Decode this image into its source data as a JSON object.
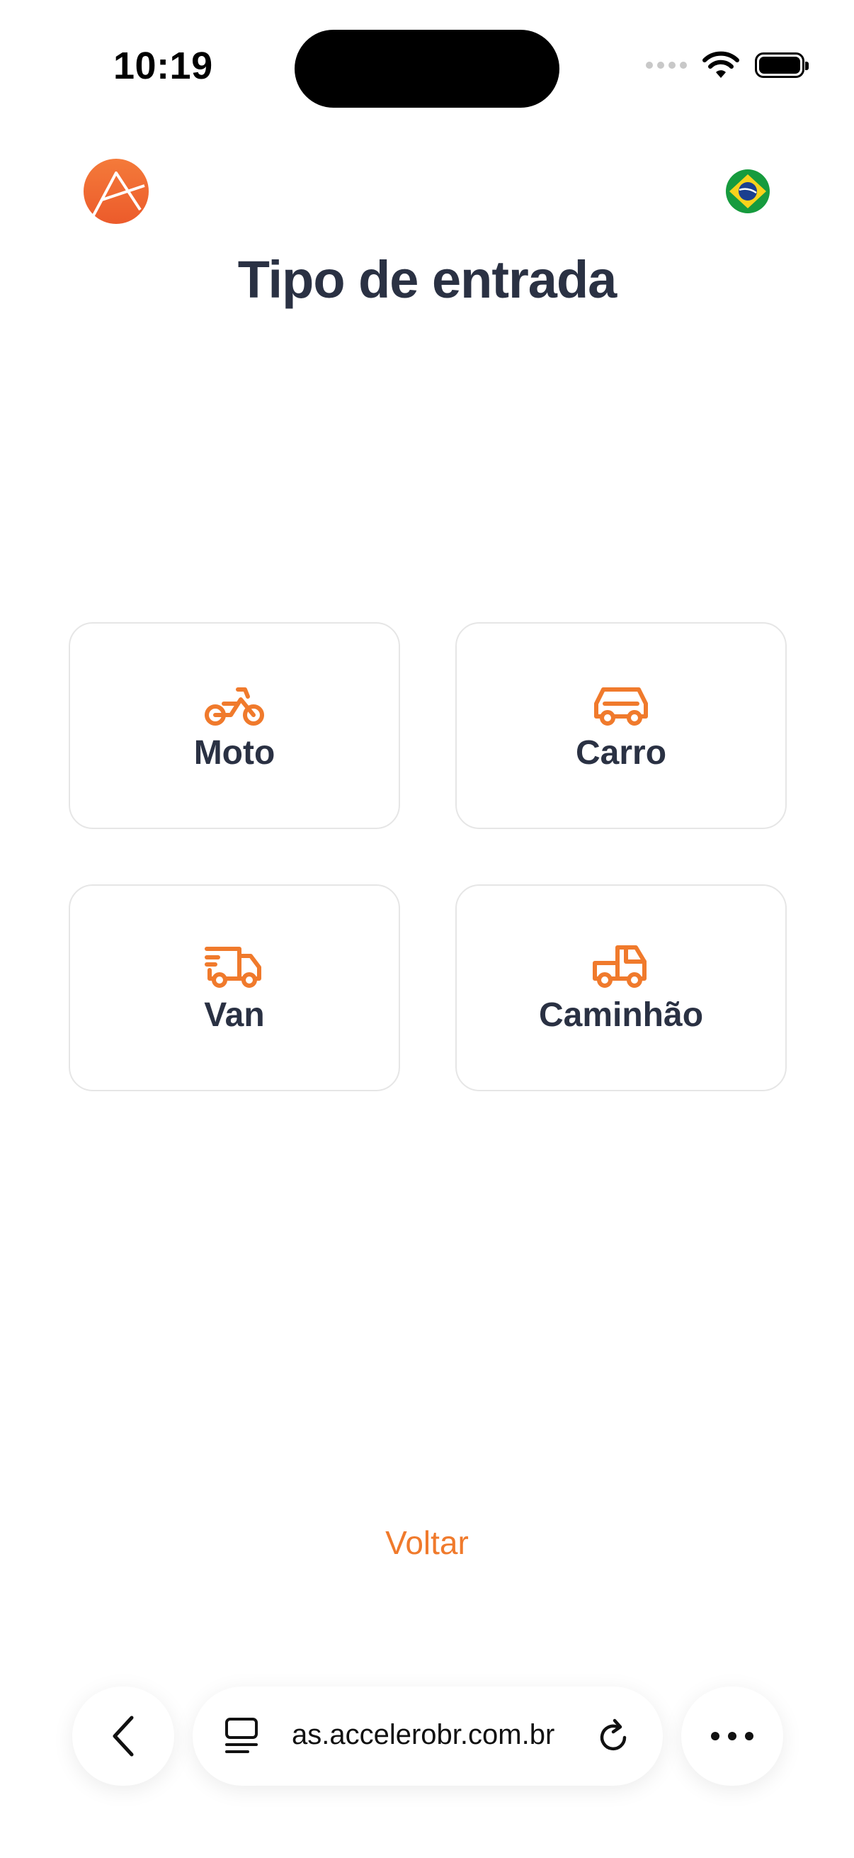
{
  "status_bar": {
    "time": "10:19"
  },
  "header": {
    "title": "Tipo de entrada"
  },
  "options": [
    {
      "label": "Moto",
      "icon": "motorcycle-icon"
    },
    {
      "label": "Carro",
      "icon": "car-icon"
    },
    {
      "label": "Van",
      "icon": "van-icon"
    },
    {
      "label": "Caminhão",
      "icon": "truck-icon"
    }
  ],
  "footer": {
    "back_label": "Voltar"
  },
  "browser": {
    "url": "as.accelerobr.com.br"
  },
  "colors": {
    "accent": "#f07a2c",
    "text": "#2a3143"
  }
}
